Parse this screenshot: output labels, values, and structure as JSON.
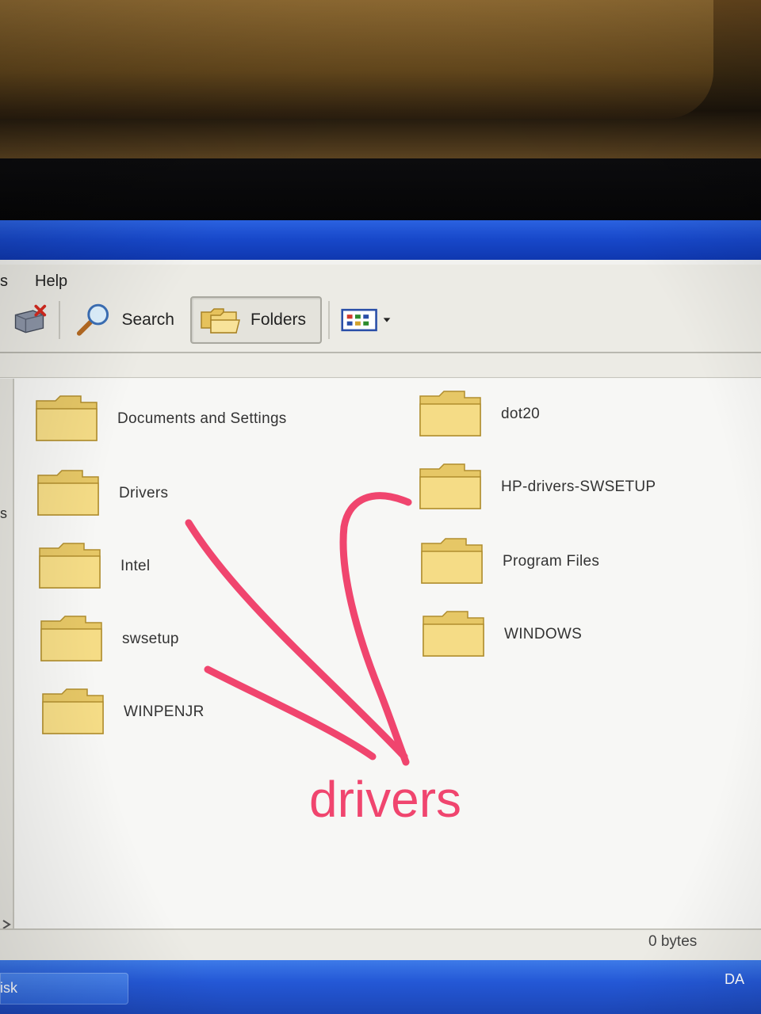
{
  "menubar": {
    "partial_item": "s",
    "help": "Help"
  },
  "toolbar": {
    "delete_icon": "delete-icon",
    "search_label": "Search",
    "folders_label": "Folders",
    "views_icon": "views-icon"
  },
  "left_pane": {
    "partial_text": "s"
  },
  "folders": {
    "left": [
      {
        "name": "Documents and Settings"
      },
      {
        "name": "Drivers"
      },
      {
        "name": "Intel"
      },
      {
        "name": "swsetup"
      },
      {
        "name": "WINPENJR"
      }
    ],
    "right": [
      {
        "name": "dot20"
      },
      {
        "name": "HP-drivers-SWSETUP"
      },
      {
        "name": "Program Files"
      },
      {
        "name": "WINDOWS"
      }
    ]
  },
  "statusbar": {
    "size": "0 bytes"
  },
  "taskbar": {
    "task_label": "isk",
    "tray_text": "DA"
  },
  "annotation": {
    "text": "drivers",
    "color": "#f0456e"
  },
  "colors": {
    "titlebar": "#1747c9",
    "folder": "#f3d77e",
    "annotation": "#f0456e"
  }
}
